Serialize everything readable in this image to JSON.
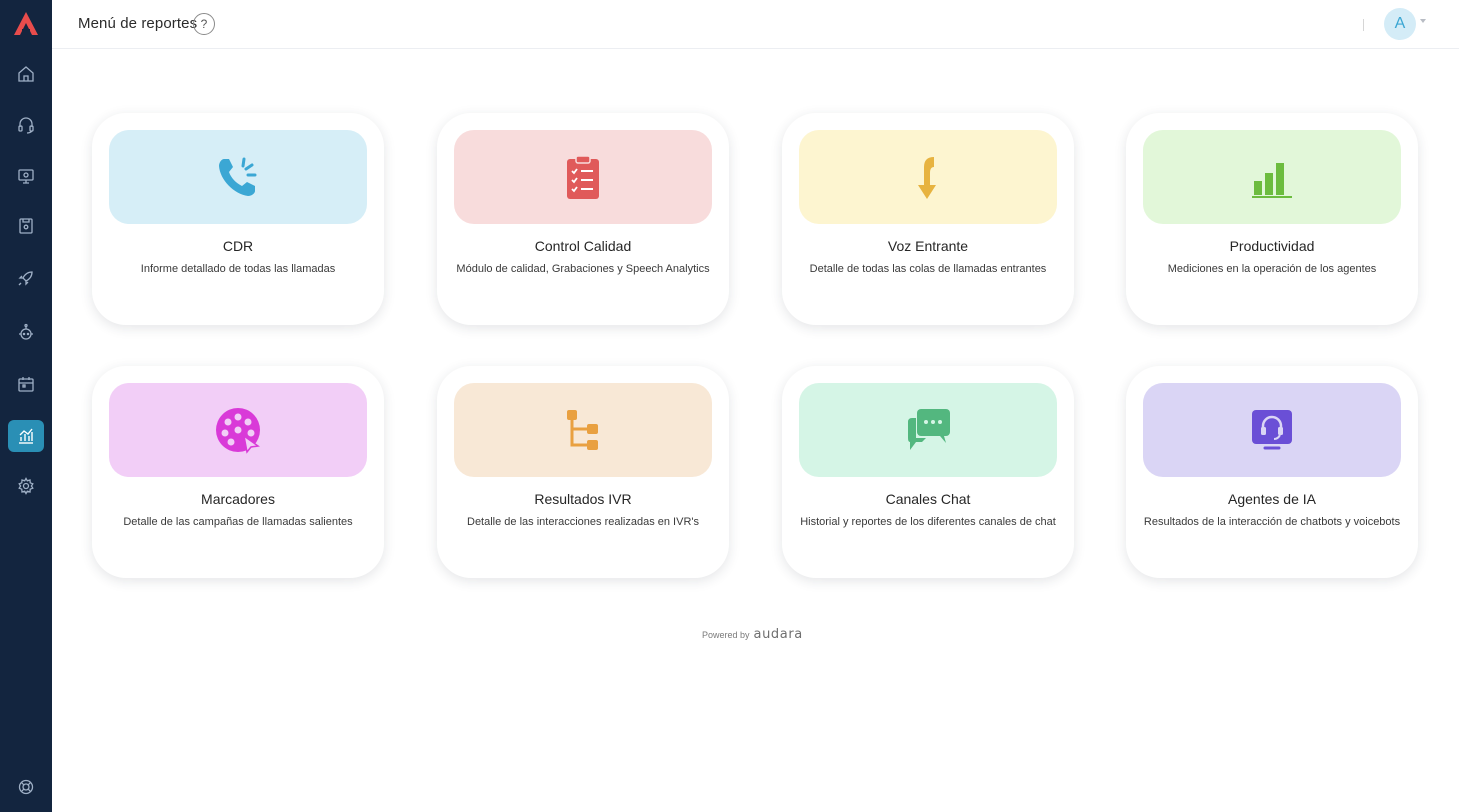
{
  "header": {
    "title": "Menú de reportes",
    "help_label": "?",
    "avatar_initial": "A"
  },
  "sidebar": {
    "items": [
      {
        "icon": "home-icon"
      },
      {
        "icon": "headset-icon"
      },
      {
        "icon": "monitor-icon"
      },
      {
        "icon": "contact-book-icon"
      },
      {
        "icon": "rocket-icon"
      },
      {
        "icon": "robot-icon"
      },
      {
        "icon": "calendar-icon"
      },
      {
        "icon": "chart-icon",
        "active": true
      },
      {
        "icon": "gear-icon"
      },
      {
        "icon": "lifebuoy-icon"
      }
    ]
  },
  "cards": [
    {
      "title": "CDR",
      "description": "Informe detallado de todas las llamadas",
      "icon": "phone-icon",
      "tile_color": "#d6eef7",
      "icon_color": "#3ba7d4"
    },
    {
      "title": "Control Calidad",
      "description": "Módulo de calidad, Grabaciones y Speech Analytics",
      "icon": "clipboard-icon",
      "tile_color": "#f8dcdc",
      "icon_color": "#e05a5a"
    },
    {
      "title": "Voz Entrante",
      "description": "Detalle de todas las colas de llamadas entrantes",
      "icon": "incoming-arrow-icon",
      "tile_color": "#fdf5d0",
      "icon_color": "#e7b340"
    },
    {
      "title": "Productividad",
      "description": "Mediciones en la operación de los agentes",
      "icon": "bar-chart-icon",
      "tile_color": "#e2f7d9",
      "icon_color": "#6cbc3e"
    },
    {
      "title": "Marcadores",
      "description": "Detalle de las campañas de llamadas salientes",
      "icon": "dialer-icon",
      "tile_color": "#f2cef7",
      "icon_color": "#d93ad8"
    },
    {
      "title": "Resultados IVR",
      "description": "Detalle de las interacciones realizadas en IVR's",
      "icon": "ivr-tree-icon",
      "tile_color": "#f8e8d6",
      "icon_color": "#e9a040"
    },
    {
      "title": "Canales Chat",
      "description": "Historial y reportes de los diferentes canales de chat",
      "icon": "chat-bubbles-icon",
      "tile_color": "#d5f5e6",
      "icon_color": "#53b77f"
    },
    {
      "title": "Agentes de IA",
      "description": "Resultados de la interacción de chatbots y voicebots",
      "icon": "ai-agent-icon",
      "tile_color": "#dad5f5",
      "icon_color": "#6a4fd6"
    }
  ],
  "footer": {
    "powered_by": "Powered by",
    "brand": "audara"
  }
}
